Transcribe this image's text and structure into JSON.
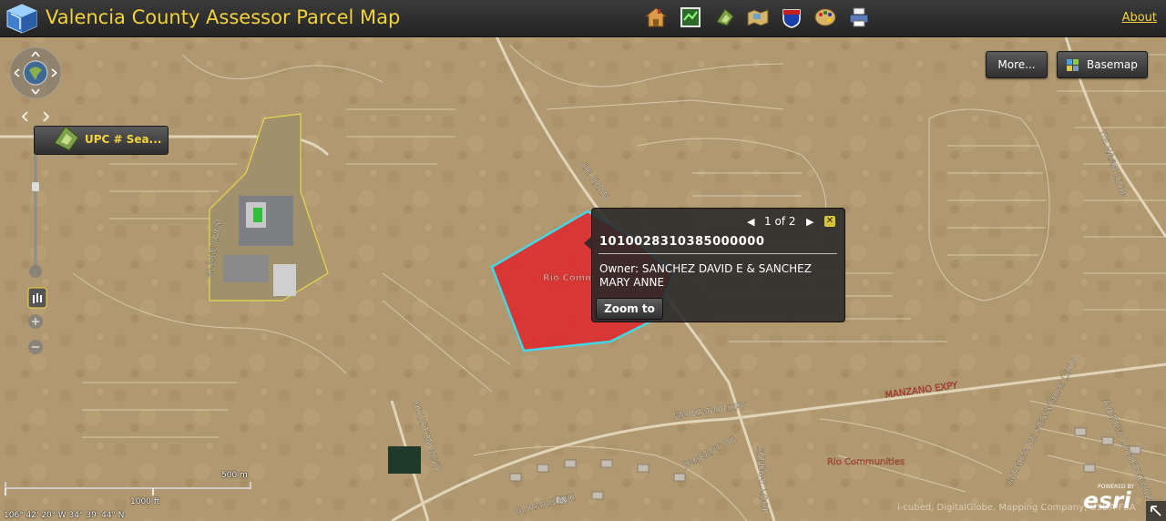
{
  "header": {
    "title": "Valencia County Assessor Parcel Map",
    "about_label": "About",
    "tools": [
      {
        "icon": "home-icon",
        "active": false
      },
      {
        "icon": "layers-map-icon",
        "active": false
      },
      {
        "icon": "parcel-search-icon",
        "active": true
      },
      {
        "icon": "map-legend-icon",
        "active": false
      },
      {
        "icon": "interstate-shield-icon",
        "active": false
      },
      {
        "icon": "palette-icon",
        "active": false
      },
      {
        "icon": "printer-icon",
        "active": false
      }
    ]
  },
  "map_controls": {
    "more_label": "More...",
    "basemap_label": "Basemap",
    "upc_search_label": "UPC # Sea..."
  },
  "popup": {
    "count": "1 of 2",
    "upc": "1010028310385000000",
    "owner": "Owner: SANCHEZ DAVID E & SANCHEZ MARY ANNE",
    "zoom_to_label": "Zoom to"
  },
  "map": {
    "road_labels": [
      "ALAME LOOP",
      "DE HAAN",
      "DE HAAN LOOP",
      "MANZANO EXPY",
      "MANZANO EXPY",
      "HOUSTON BLVD",
      "SUNDIAL LOOP",
      "PAGEANT DR",
      "GORMAN AVE",
      "AVENIDA DE MESAVERDE LOOP",
      "AVENIDA LA BIENVENIDA"
    ],
    "place_labels": [
      "Rio Communities",
      "Rio Comm"
    ],
    "highlight_color": "#e0262b",
    "outline_color": "#45d6e6"
  },
  "scalebar": {
    "metric": "500 m",
    "imperial": "1000 ft",
    "coords": "106° 42' 20\" W 34° 39' 44\" N"
  },
  "attribution": "i-cubed, DigitalGlobe, Mapping Company, USDA FSA",
  "esri": {
    "powered_by": "POWERED BY",
    "word": "esri"
  }
}
